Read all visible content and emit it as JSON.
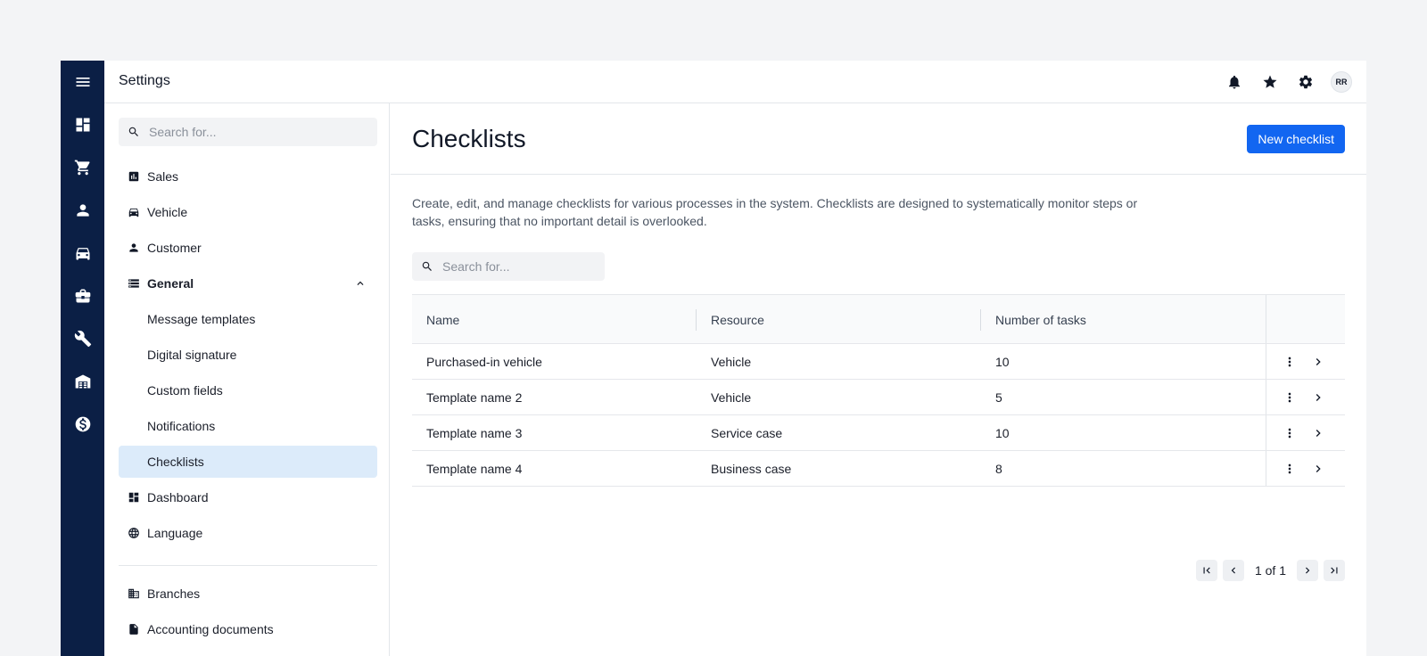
{
  "header": {
    "title": "Settings",
    "avatar_initials": "RR",
    "icons": [
      "bell-icon",
      "star-icon",
      "gear-icon"
    ]
  },
  "rail": {
    "icons": [
      "menu-icon",
      "dashboard-icon",
      "cart-icon",
      "person-icon",
      "car-icon",
      "briefcase-icon",
      "wrench-icon",
      "warehouse-icon",
      "dollar-icon"
    ]
  },
  "sidebar": {
    "search_placeholder": "Search for...",
    "items": [
      {
        "label": "Sales",
        "icon": "chart-icon"
      },
      {
        "label": "Vehicle",
        "icon": "car-icon"
      },
      {
        "label": "Customer",
        "icon": "person-icon"
      },
      {
        "label": "General",
        "icon": "storage-icon",
        "expanded": true
      },
      {
        "label": "Message templates"
      },
      {
        "label": "Digital signature"
      },
      {
        "label": "Custom fields"
      },
      {
        "label": "Notifications"
      },
      {
        "label": "Checklists",
        "active": true
      },
      {
        "label": "Dashboard",
        "icon": "dashboard-icon"
      },
      {
        "label": "Language",
        "icon": "globe-icon"
      },
      {
        "label": "Branches",
        "icon": "building-icon"
      },
      {
        "label": "Accounting documents",
        "icon": "document-icon"
      }
    ]
  },
  "main": {
    "title": "Checklists",
    "new_button": "New checklist",
    "description": "Create, edit, and manage checklists for various processes in the system. Checklists are designed to systematically monitor steps or tasks, ensuring that no important detail is overlooked.",
    "search_placeholder": "Search for...",
    "table": {
      "columns": [
        "Name",
        "Resource",
        "Number of tasks"
      ],
      "rows": [
        {
          "name": "Purchased-in vehicle",
          "resource": "Vehicle",
          "tasks": "10"
        },
        {
          "name": "Template name 2",
          "resource": "Vehicle",
          "tasks": "5"
        },
        {
          "name": "Template name 3",
          "resource": "Service case",
          "tasks": "10"
        },
        {
          "name": "Template name 4",
          "resource": "Business case",
          "tasks": "8"
        }
      ]
    },
    "pagination": {
      "text": "1 of 1"
    }
  },
  "colors": {
    "rail": "#0b1f45",
    "primary": "#1266f1",
    "active_nav": "#dcebfa"
  }
}
